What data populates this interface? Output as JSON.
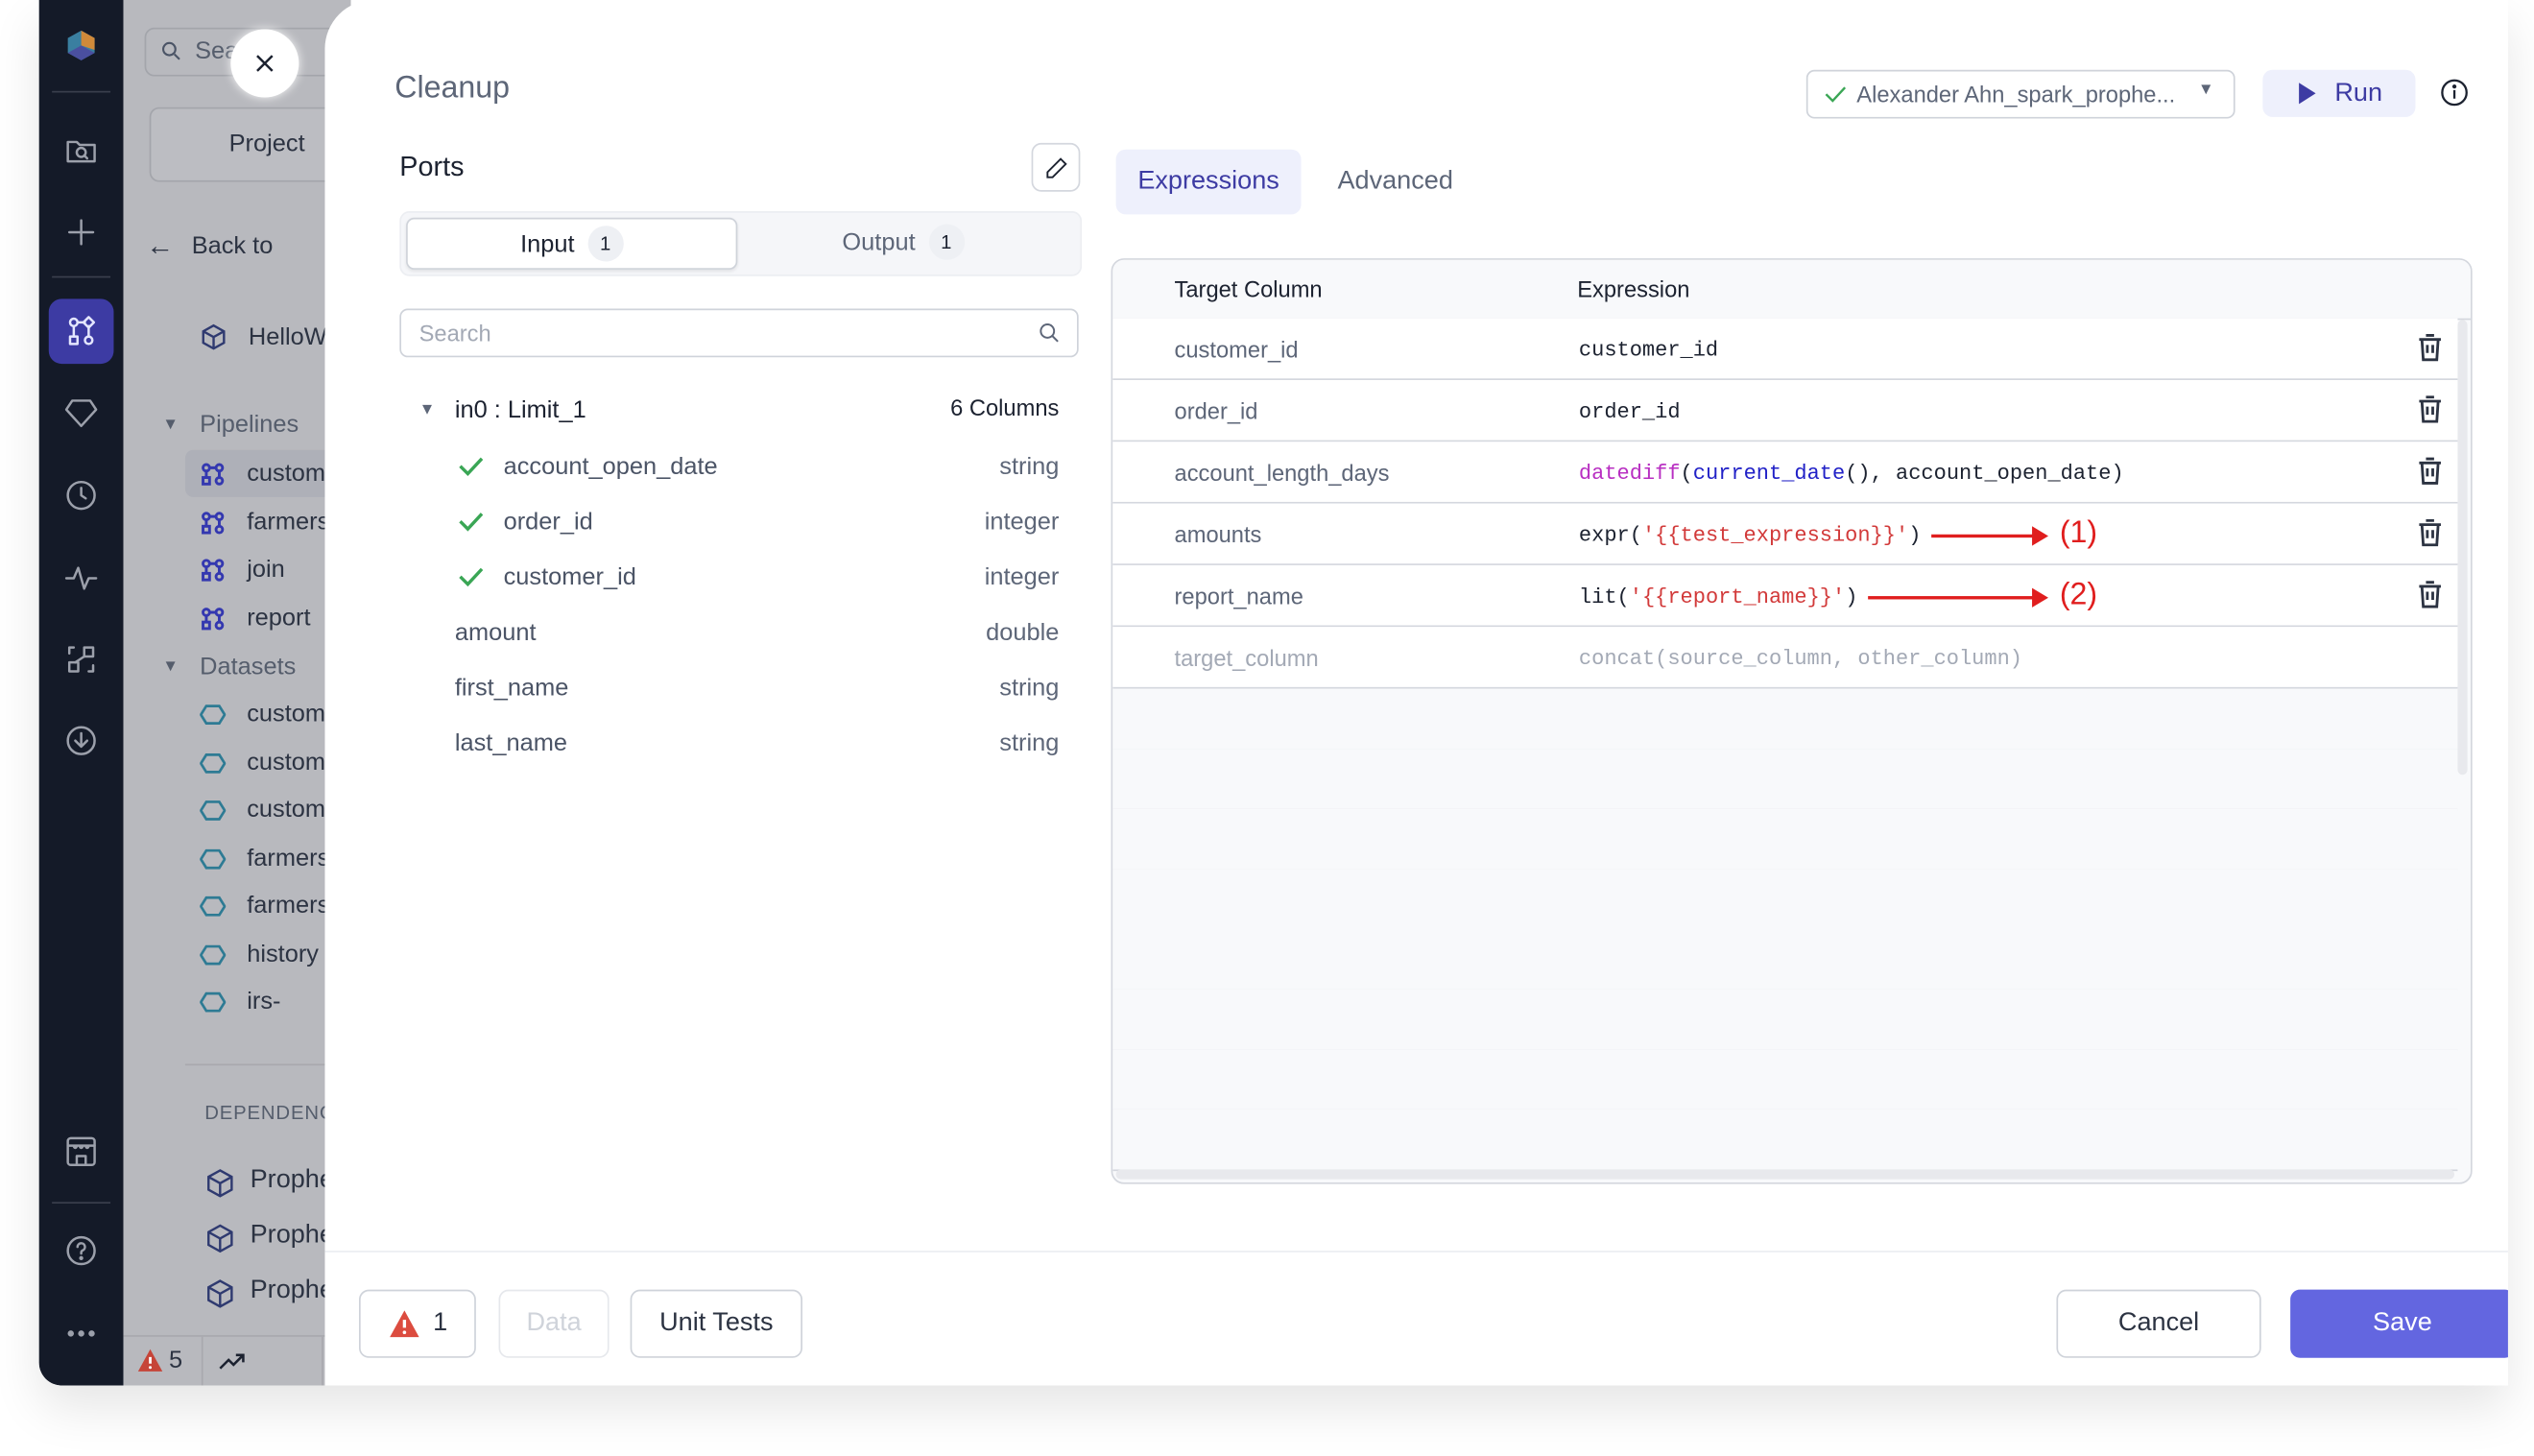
{
  "rail": {
    "icons": [
      "logo-icon",
      "folder-search-icon",
      "plus-icon",
      "pipeline-icon",
      "gem-icon",
      "clock-icon",
      "activity-icon",
      "lineage-icon",
      "download-icon",
      "store-icon",
      "help-icon",
      "more-icon"
    ]
  },
  "project_sidebar": {
    "search_placeholder": "Search",
    "project_button": "Project",
    "back_label": "Back to",
    "project_name": "HelloWorld",
    "pipelines_header": "Pipelines",
    "pipelines": [
      "customers",
      "farmers",
      "join",
      "report"
    ],
    "datasets_header": "Datasets",
    "datasets": [
      "customers",
      "customers",
      "customers",
      "farmers",
      "farmers",
      "history",
      "irs-"
    ],
    "dependencies_header": "DEPENDENCIES",
    "dependencies": [
      "Prophecy",
      "Prophecy",
      "Prophecy"
    ],
    "warning_count": "5"
  },
  "modal": {
    "title": "Cleanup",
    "fabric_selector": {
      "value": "Alexander Ahn_spark_prophe...",
      "status": "connected"
    },
    "run_label": "Run",
    "ports": {
      "label": "Ports",
      "input_tab": {
        "label": "Input",
        "count": "1"
      },
      "output_tab": {
        "label": "Output",
        "count": "1"
      },
      "selected_tab": "Input",
      "search_placeholder": "Search",
      "port_name": "in0 : Limit_1",
      "column_count": "6 Columns",
      "columns": [
        {
          "name": "account_open_date",
          "type": "string",
          "used": true
        },
        {
          "name": "order_id",
          "type": "integer",
          "used": true
        },
        {
          "name": "customer_id",
          "type": "integer",
          "used": true
        },
        {
          "name": "amount",
          "type": "double",
          "used": false
        },
        {
          "name": "first_name",
          "type": "string",
          "used": false
        },
        {
          "name": "last_name",
          "type": "string",
          "used": false
        }
      ]
    },
    "tabs": [
      {
        "label": "Expressions",
        "selected": true
      },
      {
        "label": "Advanced",
        "selected": false
      }
    ],
    "table": {
      "headers": [
        "Target Column",
        "Expression"
      ],
      "rows": [
        {
          "target": "customer_id",
          "expression": "customer_id"
        },
        {
          "target": "order_id",
          "expression": "order_id"
        },
        {
          "target": "account_length_days",
          "expression": "datediff(current_date(), account_open_date)"
        },
        {
          "target": "amounts",
          "expression": "expr('{{test_expression}}')",
          "annotation": "(1)"
        },
        {
          "target": "report_name",
          "expression": "lit('{{report_name}}')",
          "annotation": "(2)"
        }
      ],
      "placeholder_row": {
        "target": "target_column",
        "expression": "concat(source_column, other_column)"
      }
    },
    "footer": {
      "diagnostics_count": "1",
      "data_label": "Data",
      "unit_tests_label": "Unit Tests",
      "cancel_label": "Cancel",
      "save_label": "Save"
    }
  },
  "colors": {
    "accent": "#3d3ba3",
    "primary_button": "#6366e0",
    "annotation_red": "#e01e1e",
    "success_green": "#3aa655",
    "warning_red": "#dc4c3f"
  }
}
